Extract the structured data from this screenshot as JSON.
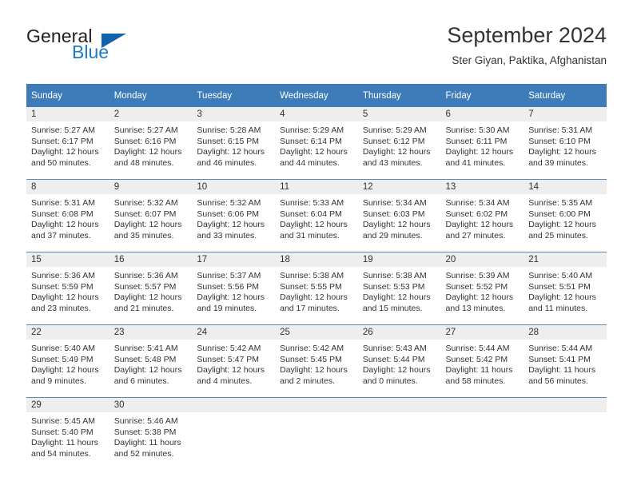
{
  "brand": {
    "word_one": "General",
    "word_two": "Blue",
    "logo_icon": "triangle-logo-icon"
  },
  "header": {
    "title": "September 2024",
    "subtitle": "Ster Giyan, Paktika, Afghanistan"
  },
  "weekday_headers": [
    "Sunday",
    "Monday",
    "Tuesday",
    "Wednesday",
    "Thursday",
    "Friday",
    "Saturday"
  ],
  "colors": {
    "header_blue": "#3d7cb8",
    "row_divider": "#5b89b8",
    "daynum_band": "#eeeeee",
    "brand_blue": "#1f7ac4",
    "text": "#333333"
  },
  "weeks": [
    [
      {
        "day": "1",
        "sunrise": "Sunrise: 5:27 AM",
        "sunset": "Sunset: 6:17 PM",
        "daylight_line1": "Daylight: 12 hours",
        "daylight_line2": "and 50 minutes."
      },
      {
        "day": "2",
        "sunrise": "Sunrise: 5:27 AM",
        "sunset": "Sunset: 6:16 PM",
        "daylight_line1": "Daylight: 12 hours",
        "daylight_line2": "and 48 minutes."
      },
      {
        "day": "3",
        "sunrise": "Sunrise: 5:28 AM",
        "sunset": "Sunset: 6:15 PM",
        "daylight_line1": "Daylight: 12 hours",
        "daylight_line2": "and 46 minutes."
      },
      {
        "day": "4",
        "sunrise": "Sunrise: 5:29 AM",
        "sunset": "Sunset: 6:14 PM",
        "daylight_line1": "Daylight: 12 hours",
        "daylight_line2": "and 44 minutes."
      },
      {
        "day": "5",
        "sunrise": "Sunrise: 5:29 AM",
        "sunset": "Sunset: 6:12 PM",
        "daylight_line1": "Daylight: 12 hours",
        "daylight_line2": "and 43 minutes."
      },
      {
        "day": "6",
        "sunrise": "Sunrise: 5:30 AM",
        "sunset": "Sunset: 6:11 PM",
        "daylight_line1": "Daylight: 12 hours",
        "daylight_line2": "and 41 minutes."
      },
      {
        "day": "7",
        "sunrise": "Sunrise: 5:31 AM",
        "sunset": "Sunset: 6:10 PM",
        "daylight_line1": "Daylight: 12 hours",
        "daylight_line2": "and 39 minutes."
      }
    ],
    [
      {
        "day": "8",
        "sunrise": "Sunrise: 5:31 AM",
        "sunset": "Sunset: 6:08 PM",
        "daylight_line1": "Daylight: 12 hours",
        "daylight_line2": "and 37 minutes."
      },
      {
        "day": "9",
        "sunrise": "Sunrise: 5:32 AM",
        "sunset": "Sunset: 6:07 PM",
        "daylight_line1": "Daylight: 12 hours",
        "daylight_line2": "and 35 minutes."
      },
      {
        "day": "10",
        "sunrise": "Sunrise: 5:32 AM",
        "sunset": "Sunset: 6:06 PM",
        "daylight_line1": "Daylight: 12 hours",
        "daylight_line2": "and 33 minutes."
      },
      {
        "day": "11",
        "sunrise": "Sunrise: 5:33 AM",
        "sunset": "Sunset: 6:04 PM",
        "daylight_line1": "Daylight: 12 hours",
        "daylight_line2": "and 31 minutes."
      },
      {
        "day": "12",
        "sunrise": "Sunrise: 5:34 AM",
        "sunset": "Sunset: 6:03 PM",
        "daylight_line1": "Daylight: 12 hours",
        "daylight_line2": "and 29 minutes."
      },
      {
        "day": "13",
        "sunrise": "Sunrise: 5:34 AM",
        "sunset": "Sunset: 6:02 PM",
        "daylight_line1": "Daylight: 12 hours",
        "daylight_line2": "and 27 minutes."
      },
      {
        "day": "14",
        "sunrise": "Sunrise: 5:35 AM",
        "sunset": "Sunset: 6:00 PM",
        "daylight_line1": "Daylight: 12 hours",
        "daylight_line2": "and 25 minutes."
      }
    ],
    [
      {
        "day": "15",
        "sunrise": "Sunrise: 5:36 AM",
        "sunset": "Sunset: 5:59 PM",
        "daylight_line1": "Daylight: 12 hours",
        "daylight_line2": "and 23 minutes."
      },
      {
        "day": "16",
        "sunrise": "Sunrise: 5:36 AM",
        "sunset": "Sunset: 5:57 PM",
        "daylight_line1": "Daylight: 12 hours",
        "daylight_line2": "and 21 minutes."
      },
      {
        "day": "17",
        "sunrise": "Sunrise: 5:37 AM",
        "sunset": "Sunset: 5:56 PM",
        "daylight_line1": "Daylight: 12 hours",
        "daylight_line2": "and 19 minutes."
      },
      {
        "day": "18",
        "sunrise": "Sunrise: 5:38 AM",
        "sunset": "Sunset: 5:55 PM",
        "daylight_line1": "Daylight: 12 hours",
        "daylight_line2": "and 17 minutes."
      },
      {
        "day": "19",
        "sunrise": "Sunrise: 5:38 AM",
        "sunset": "Sunset: 5:53 PM",
        "daylight_line1": "Daylight: 12 hours",
        "daylight_line2": "and 15 minutes."
      },
      {
        "day": "20",
        "sunrise": "Sunrise: 5:39 AM",
        "sunset": "Sunset: 5:52 PM",
        "daylight_line1": "Daylight: 12 hours",
        "daylight_line2": "and 13 minutes."
      },
      {
        "day": "21",
        "sunrise": "Sunrise: 5:40 AM",
        "sunset": "Sunset: 5:51 PM",
        "daylight_line1": "Daylight: 12 hours",
        "daylight_line2": "and 11 minutes."
      }
    ],
    [
      {
        "day": "22",
        "sunrise": "Sunrise: 5:40 AM",
        "sunset": "Sunset: 5:49 PM",
        "daylight_line1": "Daylight: 12 hours",
        "daylight_line2": "and 9 minutes."
      },
      {
        "day": "23",
        "sunrise": "Sunrise: 5:41 AM",
        "sunset": "Sunset: 5:48 PM",
        "daylight_line1": "Daylight: 12 hours",
        "daylight_line2": "and 6 minutes."
      },
      {
        "day": "24",
        "sunrise": "Sunrise: 5:42 AM",
        "sunset": "Sunset: 5:47 PM",
        "daylight_line1": "Daylight: 12 hours",
        "daylight_line2": "and 4 minutes."
      },
      {
        "day": "25",
        "sunrise": "Sunrise: 5:42 AM",
        "sunset": "Sunset: 5:45 PM",
        "daylight_line1": "Daylight: 12 hours",
        "daylight_line2": "and 2 minutes."
      },
      {
        "day": "26",
        "sunrise": "Sunrise: 5:43 AM",
        "sunset": "Sunset: 5:44 PM",
        "daylight_line1": "Daylight: 12 hours",
        "daylight_line2": "and 0 minutes."
      },
      {
        "day": "27",
        "sunrise": "Sunrise: 5:44 AM",
        "sunset": "Sunset: 5:42 PM",
        "daylight_line1": "Daylight: 11 hours",
        "daylight_line2": "and 58 minutes."
      },
      {
        "day": "28",
        "sunrise": "Sunrise: 5:44 AM",
        "sunset": "Sunset: 5:41 PM",
        "daylight_line1": "Daylight: 11 hours",
        "daylight_line2": "and 56 minutes."
      }
    ],
    [
      {
        "day": "29",
        "sunrise": "Sunrise: 5:45 AM",
        "sunset": "Sunset: 5:40 PM",
        "daylight_line1": "Daylight: 11 hours",
        "daylight_line2": "and 54 minutes."
      },
      {
        "day": "30",
        "sunrise": "Sunrise: 5:46 AM",
        "sunset": "Sunset: 5:38 PM",
        "daylight_line1": "Daylight: 11 hours",
        "daylight_line2": "and 52 minutes."
      },
      {
        "day": "",
        "sunrise": "",
        "sunset": "",
        "daylight_line1": "",
        "daylight_line2": ""
      },
      {
        "day": "",
        "sunrise": "",
        "sunset": "",
        "daylight_line1": "",
        "daylight_line2": ""
      },
      {
        "day": "",
        "sunrise": "",
        "sunset": "",
        "daylight_line1": "",
        "daylight_line2": ""
      },
      {
        "day": "",
        "sunrise": "",
        "sunset": "",
        "daylight_line1": "",
        "daylight_line2": ""
      },
      {
        "day": "",
        "sunrise": "",
        "sunset": "",
        "daylight_line1": "",
        "daylight_line2": ""
      }
    ]
  ]
}
